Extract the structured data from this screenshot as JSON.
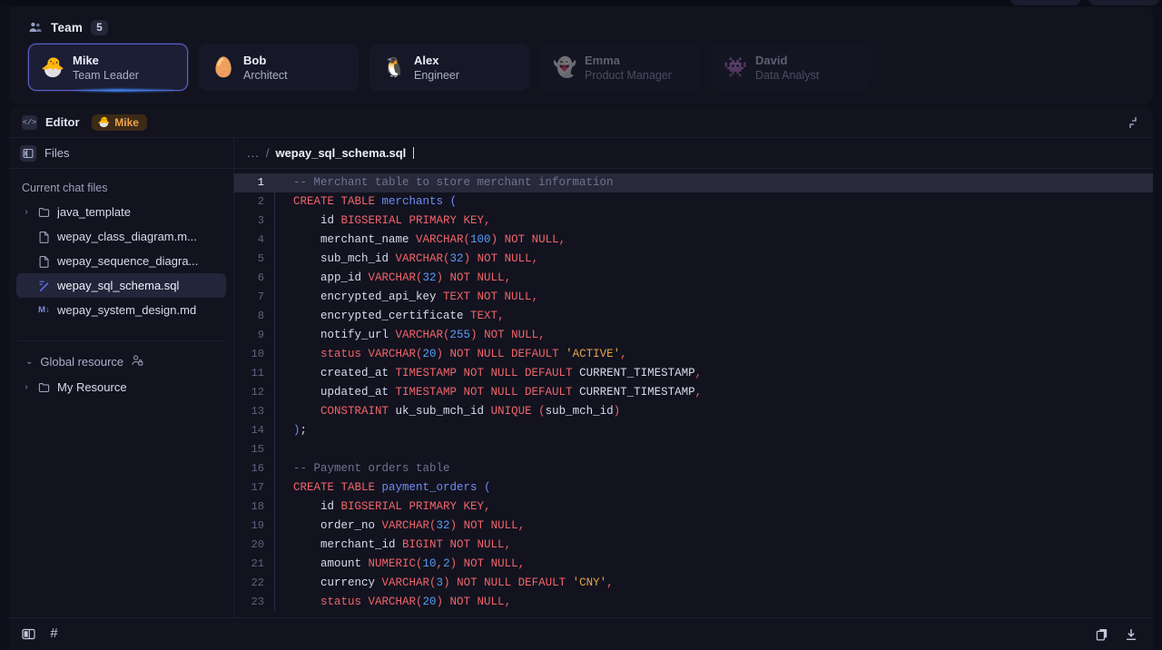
{
  "team": {
    "icon": "people-icon",
    "title": "Team",
    "count": "5",
    "members": [
      {
        "name": "Mike",
        "role": "Team Leader",
        "avatar": "🐣",
        "selected": true,
        "dim": false
      },
      {
        "name": "Bob",
        "role": "Architect",
        "avatar": "🥚",
        "selected": false,
        "dim": false
      },
      {
        "name": "Alex",
        "role": "Engineer",
        "avatar": "🐧",
        "selected": false,
        "dim": false
      },
      {
        "name": "Emma",
        "role": "Product Manager",
        "avatar": "👻",
        "selected": false,
        "dim": true
      },
      {
        "name": "David",
        "role": "Data Analyst",
        "avatar": "👾",
        "selected": false,
        "dim": true
      }
    ]
  },
  "editor": {
    "icon": "code-icon",
    "label": "Editor",
    "owner_badge": {
      "avatar": "🐣",
      "name": "Mike"
    },
    "collapse_icon": "collapse-corner-icon"
  },
  "files": {
    "panel_icon": "panel-layout-icon",
    "panel_title": "Files",
    "section_label": "Current chat files",
    "items": [
      {
        "label": "java_template",
        "kind": "folder",
        "expandable": true,
        "active": false
      },
      {
        "label": "wepay_class_diagram.m...",
        "kind": "file",
        "expandable": false,
        "active": false
      },
      {
        "label": "wepay_sequence_diagra...",
        "kind": "file",
        "expandable": false,
        "active": false
      },
      {
        "label": "wepay_sql_schema.sql",
        "kind": "sql",
        "expandable": false,
        "active": true
      },
      {
        "label": "wepay_system_design.md",
        "kind": "md",
        "expandable": false,
        "active": false
      }
    ],
    "global": {
      "label": "Global resource",
      "icon": "person-lock-icon",
      "items": [
        {
          "label": "My Resource",
          "kind": "folder",
          "expandable": true
        }
      ]
    }
  },
  "breadcrumb": {
    "dots": "...",
    "separator": "/",
    "file": "wepay_sql_schema.sql"
  },
  "code": {
    "active_line": 1,
    "lines": [
      {
        "n": 1,
        "tokens": [
          {
            "t": "cmt",
            "v": "-- Merchant table to store merchant information"
          }
        ]
      },
      {
        "n": 2,
        "tokens": [
          {
            "t": "kw",
            "v": "CREATE TABLE "
          },
          {
            "t": "ident",
            "v": "merchants"
          },
          {
            "t": "plain",
            "v": " "
          },
          {
            "t": "ident",
            "v": "("
          }
        ]
      },
      {
        "n": 3,
        "tokens": [
          {
            "t": "col",
            "v": "    id "
          },
          {
            "t": "kw",
            "v": "BIGSERIAL PRIMARY KEY"
          },
          {
            "t": "punc",
            "v": ","
          }
        ]
      },
      {
        "n": 4,
        "tokens": [
          {
            "t": "col",
            "v": "    merchant_name "
          },
          {
            "t": "kw",
            "v": "VARCHAR("
          },
          {
            "t": "num",
            "v": "100"
          },
          {
            "t": "kw",
            "v": ") NOT NULL"
          },
          {
            "t": "punc",
            "v": ","
          }
        ]
      },
      {
        "n": 5,
        "tokens": [
          {
            "t": "col",
            "v": "    sub_mch_id "
          },
          {
            "t": "kw",
            "v": "VARCHAR("
          },
          {
            "t": "num",
            "v": "32"
          },
          {
            "t": "kw",
            "v": ") NOT NULL"
          },
          {
            "t": "punc",
            "v": ","
          }
        ]
      },
      {
        "n": 6,
        "tokens": [
          {
            "t": "col",
            "v": "    app_id "
          },
          {
            "t": "kw",
            "v": "VARCHAR("
          },
          {
            "t": "num",
            "v": "32"
          },
          {
            "t": "kw",
            "v": ") NOT NULL"
          },
          {
            "t": "punc",
            "v": ","
          }
        ]
      },
      {
        "n": 7,
        "tokens": [
          {
            "t": "col",
            "v": "    encrypted_api_key "
          },
          {
            "t": "kw",
            "v": "TEXT NOT NULL"
          },
          {
            "t": "punc",
            "v": ","
          }
        ]
      },
      {
        "n": 8,
        "tokens": [
          {
            "t": "col",
            "v": "    encrypted_certificate "
          },
          {
            "t": "kw",
            "v": "TEXT"
          },
          {
            "t": "punc",
            "v": ","
          }
        ]
      },
      {
        "n": 9,
        "tokens": [
          {
            "t": "col",
            "v": "    notify_url "
          },
          {
            "t": "kw",
            "v": "VARCHAR("
          },
          {
            "t": "num",
            "v": "255"
          },
          {
            "t": "kw",
            "v": ") NOT NULL"
          },
          {
            "t": "punc",
            "v": ","
          }
        ]
      },
      {
        "n": 10,
        "tokens": [
          {
            "t": "kw",
            "v": "    status VARCHAR("
          },
          {
            "t": "num",
            "v": "20"
          },
          {
            "t": "kw",
            "v": ") NOT NULL DEFAULT "
          },
          {
            "t": "str",
            "v": "'ACTIVE'"
          },
          {
            "t": "punc",
            "v": ","
          }
        ]
      },
      {
        "n": 11,
        "tokens": [
          {
            "t": "col",
            "v": "    created_at "
          },
          {
            "t": "kw",
            "v": "TIMESTAMP NOT NULL DEFAULT "
          },
          {
            "t": "col",
            "v": "CURRENT_TIMESTAMP"
          },
          {
            "t": "punc",
            "v": ","
          }
        ]
      },
      {
        "n": 12,
        "tokens": [
          {
            "t": "col",
            "v": "    updated_at "
          },
          {
            "t": "kw",
            "v": "TIMESTAMP NOT NULL DEFAULT "
          },
          {
            "t": "col",
            "v": "CURRENT_TIMESTAMP"
          },
          {
            "t": "punc",
            "v": ","
          }
        ]
      },
      {
        "n": 13,
        "tokens": [
          {
            "t": "kw",
            "v": "    CONSTRAINT "
          },
          {
            "t": "col",
            "v": "uk_sub_mch_id "
          },
          {
            "t": "kw",
            "v": "UNIQUE "
          },
          {
            "t": "punc",
            "v": "("
          },
          {
            "t": "col",
            "v": "sub_mch_id"
          },
          {
            "t": "punc",
            "v": ")"
          }
        ]
      },
      {
        "n": 14,
        "tokens": [
          {
            "t": "ident",
            "v": ")"
          },
          {
            "t": "col",
            "v": ";"
          }
        ]
      },
      {
        "n": 15,
        "tokens": [
          {
            "t": "plain",
            "v": ""
          }
        ]
      },
      {
        "n": 16,
        "tokens": [
          {
            "t": "cmt",
            "v": "-- Payment orders table"
          }
        ]
      },
      {
        "n": 17,
        "tokens": [
          {
            "t": "kw",
            "v": "CREATE TABLE "
          },
          {
            "t": "ident",
            "v": "payment_orders"
          },
          {
            "t": "plain",
            "v": " "
          },
          {
            "t": "ident",
            "v": "("
          }
        ]
      },
      {
        "n": 18,
        "tokens": [
          {
            "t": "col",
            "v": "    id "
          },
          {
            "t": "kw",
            "v": "BIGSERIAL PRIMARY KEY"
          },
          {
            "t": "punc",
            "v": ","
          }
        ]
      },
      {
        "n": 19,
        "tokens": [
          {
            "t": "col",
            "v": "    order_no "
          },
          {
            "t": "kw",
            "v": "VARCHAR("
          },
          {
            "t": "num",
            "v": "32"
          },
          {
            "t": "kw",
            "v": ") NOT NULL"
          },
          {
            "t": "punc",
            "v": ","
          }
        ]
      },
      {
        "n": 20,
        "tokens": [
          {
            "t": "col",
            "v": "    merchant_id "
          },
          {
            "t": "kw",
            "v": "BIGINT NOT NULL"
          },
          {
            "t": "punc",
            "v": ","
          }
        ]
      },
      {
        "n": 21,
        "tokens": [
          {
            "t": "col",
            "v": "    amount "
          },
          {
            "t": "kw",
            "v": "NUMERIC("
          },
          {
            "t": "num",
            "v": "10"
          },
          {
            "t": "punc",
            "v": ","
          },
          {
            "t": "num",
            "v": "2"
          },
          {
            "t": "kw",
            "v": ") NOT NULL"
          },
          {
            "t": "punc",
            "v": ","
          }
        ]
      },
      {
        "n": 22,
        "tokens": [
          {
            "t": "col",
            "v": "    currency "
          },
          {
            "t": "kw",
            "v": "VARCHAR("
          },
          {
            "t": "num",
            "v": "3"
          },
          {
            "t": "kw",
            "v": ") NOT NULL DEFAULT "
          },
          {
            "t": "str",
            "v": "'CNY'"
          },
          {
            "t": "punc",
            "v": ","
          }
        ]
      },
      {
        "n": 23,
        "tokens": [
          {
            "t": "kw",
            "v": "    status VARCHAR("
          },
          {
            "t": "num",
            "v": "20"
          },
          {
            "t": "kw",
            "v": ") NOT NULL"
          },
          {
            "t": "punc",
            "v": ","
          }
        ]
      }
    ]
  },
  "status_bar": {
    "left_icons": [
      "panel-toggle-icon",
      "hash-icon"
    ],
    "right_icons": [
      "copy-icon",
      "download-icon"
    ],
    "hash_glyph": "#"
  }
}
